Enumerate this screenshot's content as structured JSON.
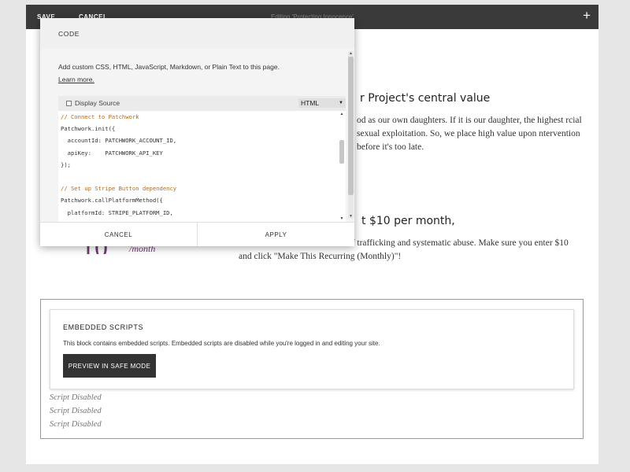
{
  "topbar": {
    "save_label": "SAVE",
    "cancel_label": "CANCEL",
    "editing_title": "Editing 'Protecting Innocence'",
    "add_icon": "plus-icon"
  },
  "page": {
    "heading_value": "r Project's central value",
    "value_text": "od as our own daughters. If it is our daughter, the highest rcial sexual exploitation. So, we place high value upon ntervention before it's too late.",
    "heading_month": "t $10 per month,",
    "month_text": "and the world who are at-risk of trafficking and systematic abuse. Make sure you enter $10 and click \"Make This Recurring (Monthly)\"!",
    "big_number": "10",
    "per_month": "/month"
  },
  "embed": {
    "title": "EMBEDDED SCRIPTS",
    "description": "This block contains embedded scripts. Embedded scripts are disabled while you're logged in and editing your site.",
    "preview_label": "PREVIEW IN SAFE MODE",
    "disabled": [
      "Script Disabled",
      "Script Disabled",
      "Script Disabled"
    ]
  },
  "modal": {
    "title": "CODE",
    "description": "Add custom CSS, HTML, JavaScript, Markdown, or Plain Text to this page.",
    "learn_more": "Learn more.",
    "display_source_label": "Display Source",
    "display_source_checked": false,
    "language": "HTML",
    "code_lines": [
      {
        "text": "// Connect to Patchwork",
        "type": "comment"
      },
      {
        "text": "Patchwork.init({",
        "type": "code"
      },
      {
        "text": "  accountId: PATCHWORK_ACCOUNT_ID,",
        "type": "code"
      },
      {
        "text": "  apiKey:    PATCHWORK_API_KEY",
        "type": "code"
      },
      {
        "text": "});",
        "type": "code"
      },
      {
        "text": "",
        "type": "code"
      },
      {
        "text": "// Set up Stripe Button dependency",
        "type": "comment"
      },
      {
        "text": "Patchwork.callPlatformMethod({",
        "type": "code"
      },
      {
        "text": "  platformId: STRIPE_PLATFORM_ID,",
        "type": "code"
      }
    ],
    "cancel_label": "CANCEL",
    "apply_label": "APPLY"
  }
}
